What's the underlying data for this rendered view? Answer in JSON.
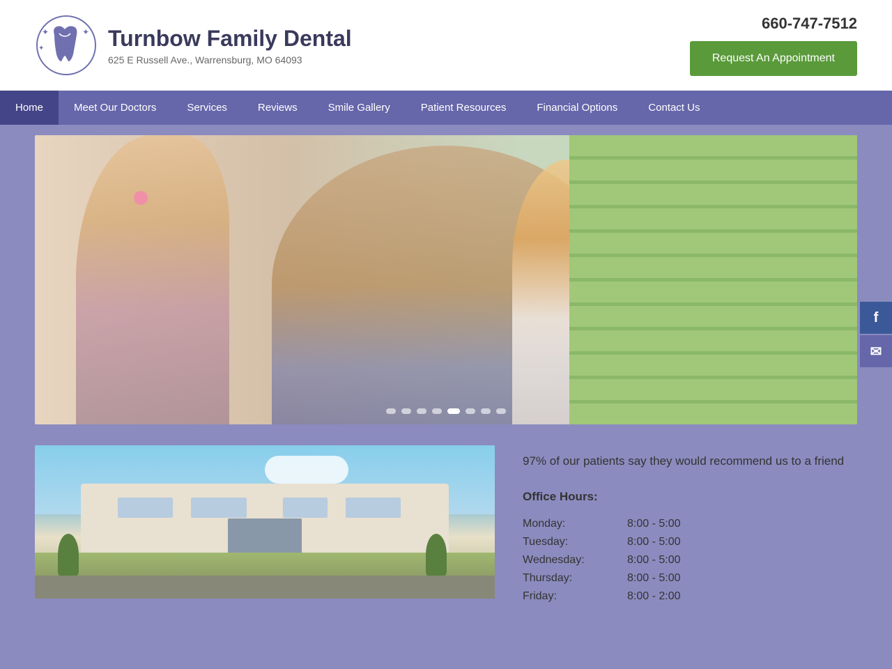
{
  "site": {
    "name": "Turnbow Family Dental",
    "address": "625 E Russell Ave., Warrensburg, MO 64093",
    "phone": "660-747-7512",
    "appointment_btn": "Request An Appointment"
  },
  "nav": {
    "items": [
      {
        "label": "Home",
        "active": true
      },
      {
        "label": "Meet Our Doctors",
        "active": false
      },
      {
        "label": "Services",
        "active": false
      },
      {
        "label": "Reviews",
        "active": false
      },
      {
        "label": "Smile Gallery",
        "active": false
      },
      {
        "label": "Patient Resources",
        "active": false
      },
      {
        "label": "Financial Options",
        "active": false
      },
      {
        "label": "Contact Us",
        "active": false
      }
    ]
  },
  "hero": {
    "dots": 8,
    "active_dot": 4
  },
  "main": {
    "testimonial": "97% of our patients say they would recommend us to a friend",
    "office_hours_title": "Office Hours:",
    "hours": [
      {
        "day": "Monday:",
        "time": "8:00 - 5:00"
      },
      {
        "day": "Tuesday:",
        "time": "8:00 - 5:00"
      },
      {
        "day": "Wednesday:",
        "time": "8:00 - 5:00"
      },
      {
        "day": "Thursday:",
        "time": "8:00 - 5:00"
      },
      {
        "day": "Friday:",
        "time": "8:00 - 2:00"
      }
    ]
  },
  "social": {
    "facebook_label": "f",
    "email_label": "✉"
  }
}
